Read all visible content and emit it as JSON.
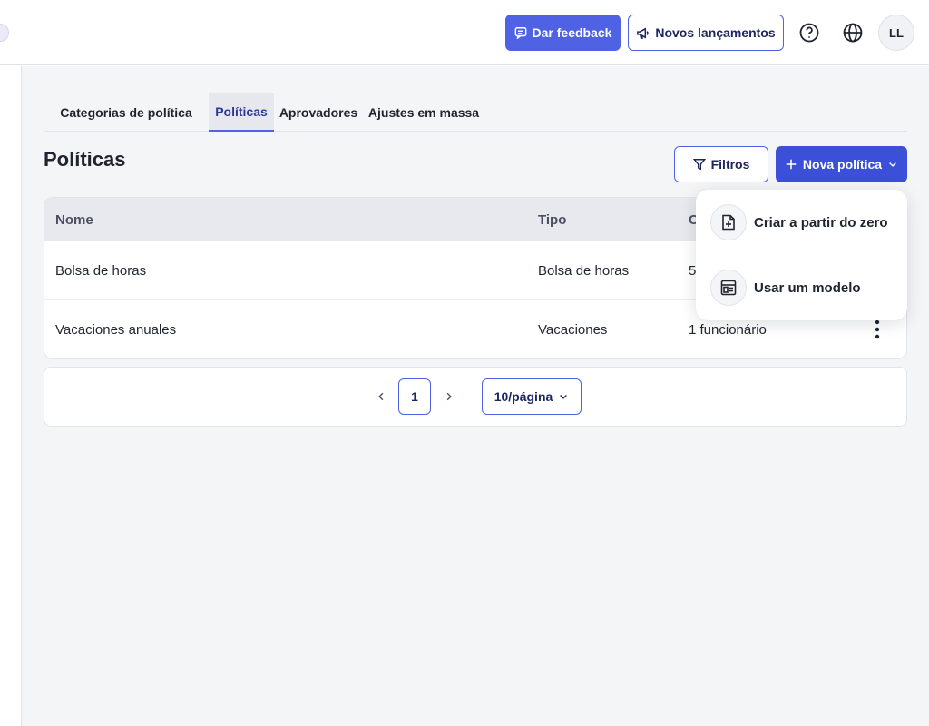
{
  "header": {
    "feedback_label": "Dar feedback",
    "releases_label": "Novos lançamentos",
    "avatar_initials": "LL"
  },
  "tabs": [
    {
      "label": "Categorias de política"
    },
    {
      "label": "Políticas"
    },
    {
      "label": "Aprovadores"
    },
    {
      "label": "Ajustes em massa"
    }
  ],
  "page": {
    "title": "Políticas",
    "filters_label": "Filtros",
    "new_policy_label": "Nova política"
  },
  "table": {
    "columns": [
      "Nome",
      "Tipo",
      "C"
    ],
    "rows": [
      {
        "name": "Bolsa de horas",
        "type": "Bolsa de horas",
        "count": "5"
      },
      {
        "name": "Vacaciones anuales",
        "type": "Vacaciones",
        "count": "1 funcionário"
      }
    ]
  },
  "pagination": {
    "current_page": "1",
    "page_size": "10/página"
  },
  "dropdown": {
    "items": [
      {
        "label": "Criar a partir do zero",
        "icon": "file-plus-icon"
      },
      {
        "label": "Usar um modelo",
        "icon": "template-icon"
      }
    ]
  },
  "colors": {
    "primary": "#3b4fd8",
    "primary_light": "#4f62e3",
    "background": "#f4f5f7"
  }
}
